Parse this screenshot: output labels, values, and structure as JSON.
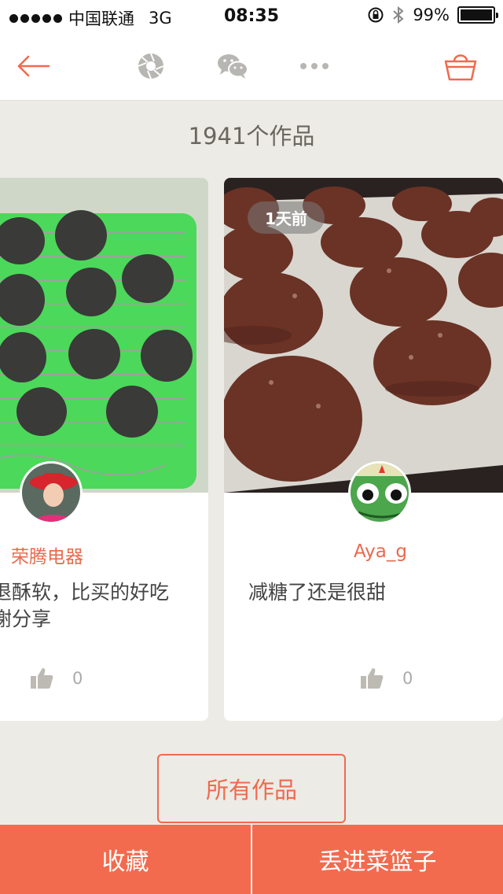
{
  "status_bar": {
    "carrier": "中国联通",
    "network": "3G",
    "time": "08:35",
    "battery": "99%",
    "battery_level": 0.99
  },
  "nav": {
    "back_icon": "back-arrow-icon",
    "camera_icon": "camera-shutter-icon",
    "wechat_icon": "wechat-icon",
    "more_icon": "more-dots-icon",
    "basket_icon": "basket-icon",
    "accent_color": "#ef6a4e"
  },
  "works_count": "1941个作品",
  "cards": [
    {
      "username": "荣腾电器",
      "desc_line1": "退酥软，比买的好吃",
      "desc_line2": "谢分享",
      "like_count": "0"
    },
    {
      "time_badge": "1天前",
      "username": "Aya_g",
      "desc_line1": "减糖了还是很甜",
      "like_count": "0"
    }
  ],
  "all_works_label": "所有作品",
  "bottom_bar": {
    "favorite_label": "收藏",
    "add_to_basket_label": "丢进菜篮子",
    "color": "#f26b4f"
  }
}
